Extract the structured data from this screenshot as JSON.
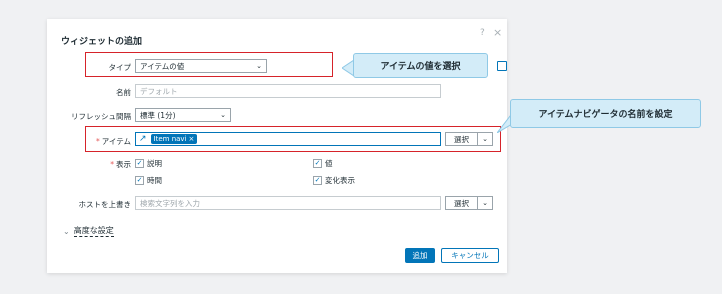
{
  "dialog": {
    "title": "ウィジェットの追加",
    "help_glyph": "?",
    "close_glyph": "×"
  },
  "form": {
    "type_label": "タイプ",
    "type_value": "アイテムの値",
    "name_label": "名前",
    "name_placeholder": "デフォルト",
    "refresh_label": "リフレッシュ間隔",
    "refresh_value": "標準 (1分)",
    "item_label": "アイテム",
    "item_tag": "Item navi",
    "item_tag_remove": "×",
    "select_button": "選択",
    "show_label": "表示",
    "show_options": [
      {
        "label": "説明",
        "checked": true
      },
      {
        "label": "値",
        "checked": true
      },
      {
        "label": "時間",
        "checked": true
      },
      {
        "label": "変化表示",
        "checked": true
      }
    ],
    "host_override_label": "ホストを上書き",
    "host_override_placeholder": "検索文字列を入力",
    "advanced_label": "高度な設定"
  },
  "buttons": {
    "add": "追加",
    "cancel": "キャンセル"
  },
  "callouts": {
    "select_value": "アイテムの値を選択",
    "set_name": "アイテムナビゲータの名前を設定"
  },
  "colors": {
    "accent": "#0275b8",
    "highlight_border": "#d6232a",
    "callout_bg": "#d3ecf8",
    "required": "#e45959"
  }
}
